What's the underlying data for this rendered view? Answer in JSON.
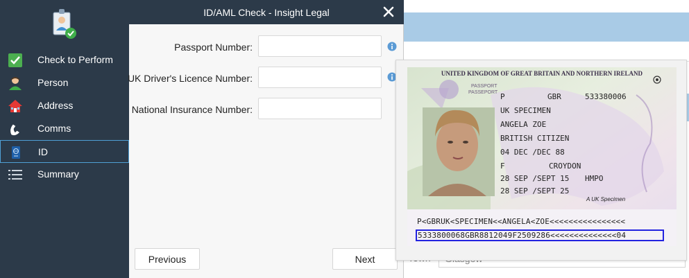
{
  "dialog": {
    "title": "ID/AML Check - Insight Legal",
    "fields": [
      {
        "label": "Passport Number:",
        "value": "",
        "placeholder": ""
      },
      {
        "label": "UK Driver's Licence Number:",
        "value": "",
        "placeholder": ""
      },
      {
        "label": "National Insurance Number:",
        "value": "",
        "placeholder": ""
      }
    ],
    "previous_label": "Previous",
    "next_label": "Next"
  },
  "sidebar": {
    "items": [
      {
        "label": "Check to Perform",
        "icon": "checkmark-icon",
        "active": false
      },
      {
        "label": "Person",
        "icon": "person-icon",
        "active": false
      },
      {
        "label": "Address",
        "icon": "house-icon",
        "active": false
      },
      {
        "label": "Comms",
        "icon": "phone-icon",
        "active": false
      },
      {
        "label": "ID",
        "icon": "passport-icon",
        "active": true
      },
      {
        "label": "Summary",
        "icon": "list-icon",
        "active": false
      }
    ]
  },
  "background": {
    "town_label": "Town",
    "town_value": "Glasgow"
  },
  "passport": {
    "header": "UNITED KINGDOM OF GREAT BRITAIN AND NORTHERN IRELAND",
    "doc_label": "PASSPORT",
    "doc_label_fr": "PASSEPORT",
    "type": "P",
    "code": "GBR",
    "number": "533380006",
    "surname": "UK SPECIMEN",
    "given_names": "ANGELA ZOE",
    "nationality": "BRITISH CITIZEN",
    "date_of_birth": "04 DEC /DEC 88",
    "sex": "F",
    "place_of_birth": "CROYDON",
    "date_of_issue": "28 SEP /SEPT 15",
    "authority": "HMPO",
    "date_of_expiry": "28 SEP /SEPT 25",
    "signature": "A UK Specimen",
    "mrz_line1": "P<GBRUK<SPECIMEN<<ANGELA<ZOE<<<<<<<<<<<<<<<<",
    "mrz_line2": "5333800068GBR8812049F2509286<<<<<<<<<<<<<<04"
  },
  "colors": {
    "sidebar_bg": "#2c3a49",
    "active_border": "#4fa0d6",
    "mrz_highlight": "#2323e0",
    "info_icon": "#5b9bd5"
  }
}
